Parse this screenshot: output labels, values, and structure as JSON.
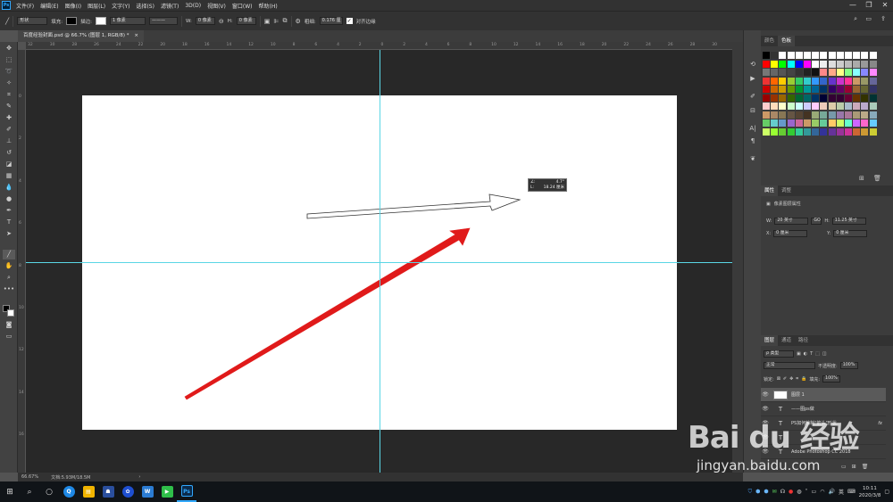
{
  "app": {
    "logo": "Ps"
  },
  "menu": [
    "文件(F)",
    "编辑(E)",
    "图像(I)",
    "图层(L)",
    "文字(Y)",
    "选择(S)",
    "滤镜(T)",
    "3D(D)",
    "视图(V)",
    "窗口(W)",
    "帮助(H)"
  ],
  "window_controls": {
    "minimize": "—",
    "restore": "❐",
    "close": "✕"
  },
  "options": {
    "mode": "形状",
    "fill_label": "填充:",
    "stroke_label": "描边:",
    "stroke_width": "1 像素",
    "w_label": "W:",
    "w_value": "0 像素",
    "h_label": "H:",
    "h_value": "0 像素",
    "weight_label": "粗细:",
    "weight_value": "0.176 厘",
    "align_label": "对齐边缘"
  },
  "document": {
    "tab_title": "百度经验封面.psd @ 66.7% (图层 1, RGB/8) *",
    "tab_close": "×"
  },
  "ruler_top_ticks": [
    "32",
    "30",
    "28",
    "26",
    "24",
    "22",
    "20",
    "18",
    "16",
    "14",
    "12",
    "10",
    "8",
    "6",
    "4",
    "2",
    "0",
    "2",
    "4",
    "6",
    "8",
    "10",
    "12",
    "14",
    "16",
    "18",
    "20",
    "22",
    "24",
    "26",
    "28",
    "30"
  ],
  "ruler_left_ticks": [
    "0",
    "2",
    "4",
    "6",
    "8",
    "10",
    "12",
    "14",
    "16",
    "18"
  ],
  "tooltip": {
    "angle_label": "∠:",
    "angle_value": "4.7°",
    "length_label": "L:",
    "length_value": "18.24 厘米"
  },
  "panels": {
    "swatch_tabs": [
      "颜色",
      "色板"
    ],
    "props_tabs": [
      "属性",
      "调整"
    ],
    "props_title": "像素图层属性",
    "props_w_label": "W:",
    "props_w_value": "20 英寸",
    "props_link": "GO",
    "props_h_label": "H:",
    "props_h_value": "11.25 英寸",
    "props_x_label": "X:",
    "props_x_value": "0 厘米",
    "props_y_label": "Y:",
    "props_y_value": "0 厘米",
    "layers_tabs": [
      "图层",
      "通道",
      "路径"
    ],
    "layer_filter": "ρ 类型",
    "blend_mode": "正常",
    "opacity_label": "不透明度:",
    "opacity_value": "100%",
    "lock_label": "锁定:",
    "fill_label": "填充:",
    "fill_value": "100%",
    "layers": [
      {
        "name": "图层 1",
        "type": "pixel",
        "selected": true
      },
      {
        "name": "——图ps做",
        "type": "text"
      },
      {
        "name": "PS如何绘制\"箭头\"形状",
        "type": "text",
        "fx": "fx"
      },
      {
        "name": "",
        "type": "text"
      },
      {
        "name": "Adobe Photoshop CC 2018",
        "type": "text"
      }
    ]
  },
  "status": {
    "zoom": "66.67%",
    "doc_size": "文档:5.93M/18.5M",
    "arrow": "›"
  },
  "taskbar": {
    "apps": [
      {
        "label": "Q",
        "color": "#1e88e5"
      },
      {
        "label": "▤",
        "color": "#f0b400"
      },
      {
        "label": "☗",
        "color": "#2a4f9e"
      },
      {
        "label": "✿",
        "color": "#1e4fd0"
      },
      {
        "label": "W",
        "color": "#2b7cd3"
      },
      {
        "label": "▶",
        "color": "#2fbf4a"
      },
      {
        "label": "Ps",
        "color": "#0b2a4a"
      }
    ],
    "ime": "英",
    "time": "10:11",
    "date": "2020/3/8"
  },
  "watermark": {
    "brand": "Bai du 经验",
    "url": "jingyan.baidu.com"
  },
  "colors": {
    "accent": "#31a8ff",
    "arrow_red": "#e01a1a",
    "guide": "#5ad6e5"
  }
}
